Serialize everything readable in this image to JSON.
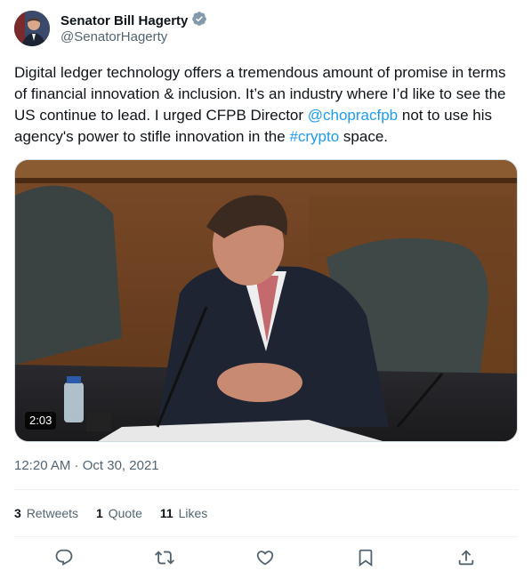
{
  "author": {
    "name": "Senator Bill Hagerty",
    "handle": "@SenatorHagerty",
    "verified_badge": "verified-badge-icon",
    "badge_color": "#71767b"
  },
  "tweet": {
    "text_before_mention": "Digital ledger technology offers a tremendous amount of promise in terms of financial innovation & inclusion. It’s an industry where I’d like to see the US continue to lead. I urged CFPB Director ",
    "mention": "@chopracfpb",
    "text_middle": " not to use his agency's power to stifle innovation in the ",
    "hashtag": "#crypto",
    "text_end": " space.",
    "link_color": "#1d9bf0"
  },
  "media": {
    "type": "video",
    "duration": "2:03"
  },
  "meta": {
    "time": "12:20 AM",
    "separator": " · ",
    "date": "Oct 30, 2021"
  },
  "stats": {
    "retweets_count": "3",
    "retweets_label": "Retweets",
    "quotes_count": "1",
    "quotes_label": "Quote",
    "likes_count": "11",
    "likes_label": "Likes"
  },
  "actions": [
    "reply-icon",
    "retweet-icon",
    "like-icon",
    "bookmark-icon",
    "share-icon"
  ]
}
